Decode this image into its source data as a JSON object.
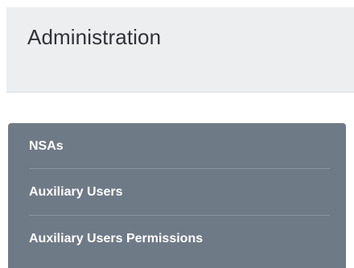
{
  "header": {
    "title": "Administration"
  },
  "menu": {
    "items": [
      {
        "label": "NSAs"
      },
      {
        "label": "Auxiliary Users"
      },
      {
        "label": "Auxiliary Users Permissions"
      }
    ]
  },
  "colors": {
    "header_bg": "#edeef0",
    "menu_bg": "#6f7a87",
    "menu_text": "#ffffff"
  }
}
